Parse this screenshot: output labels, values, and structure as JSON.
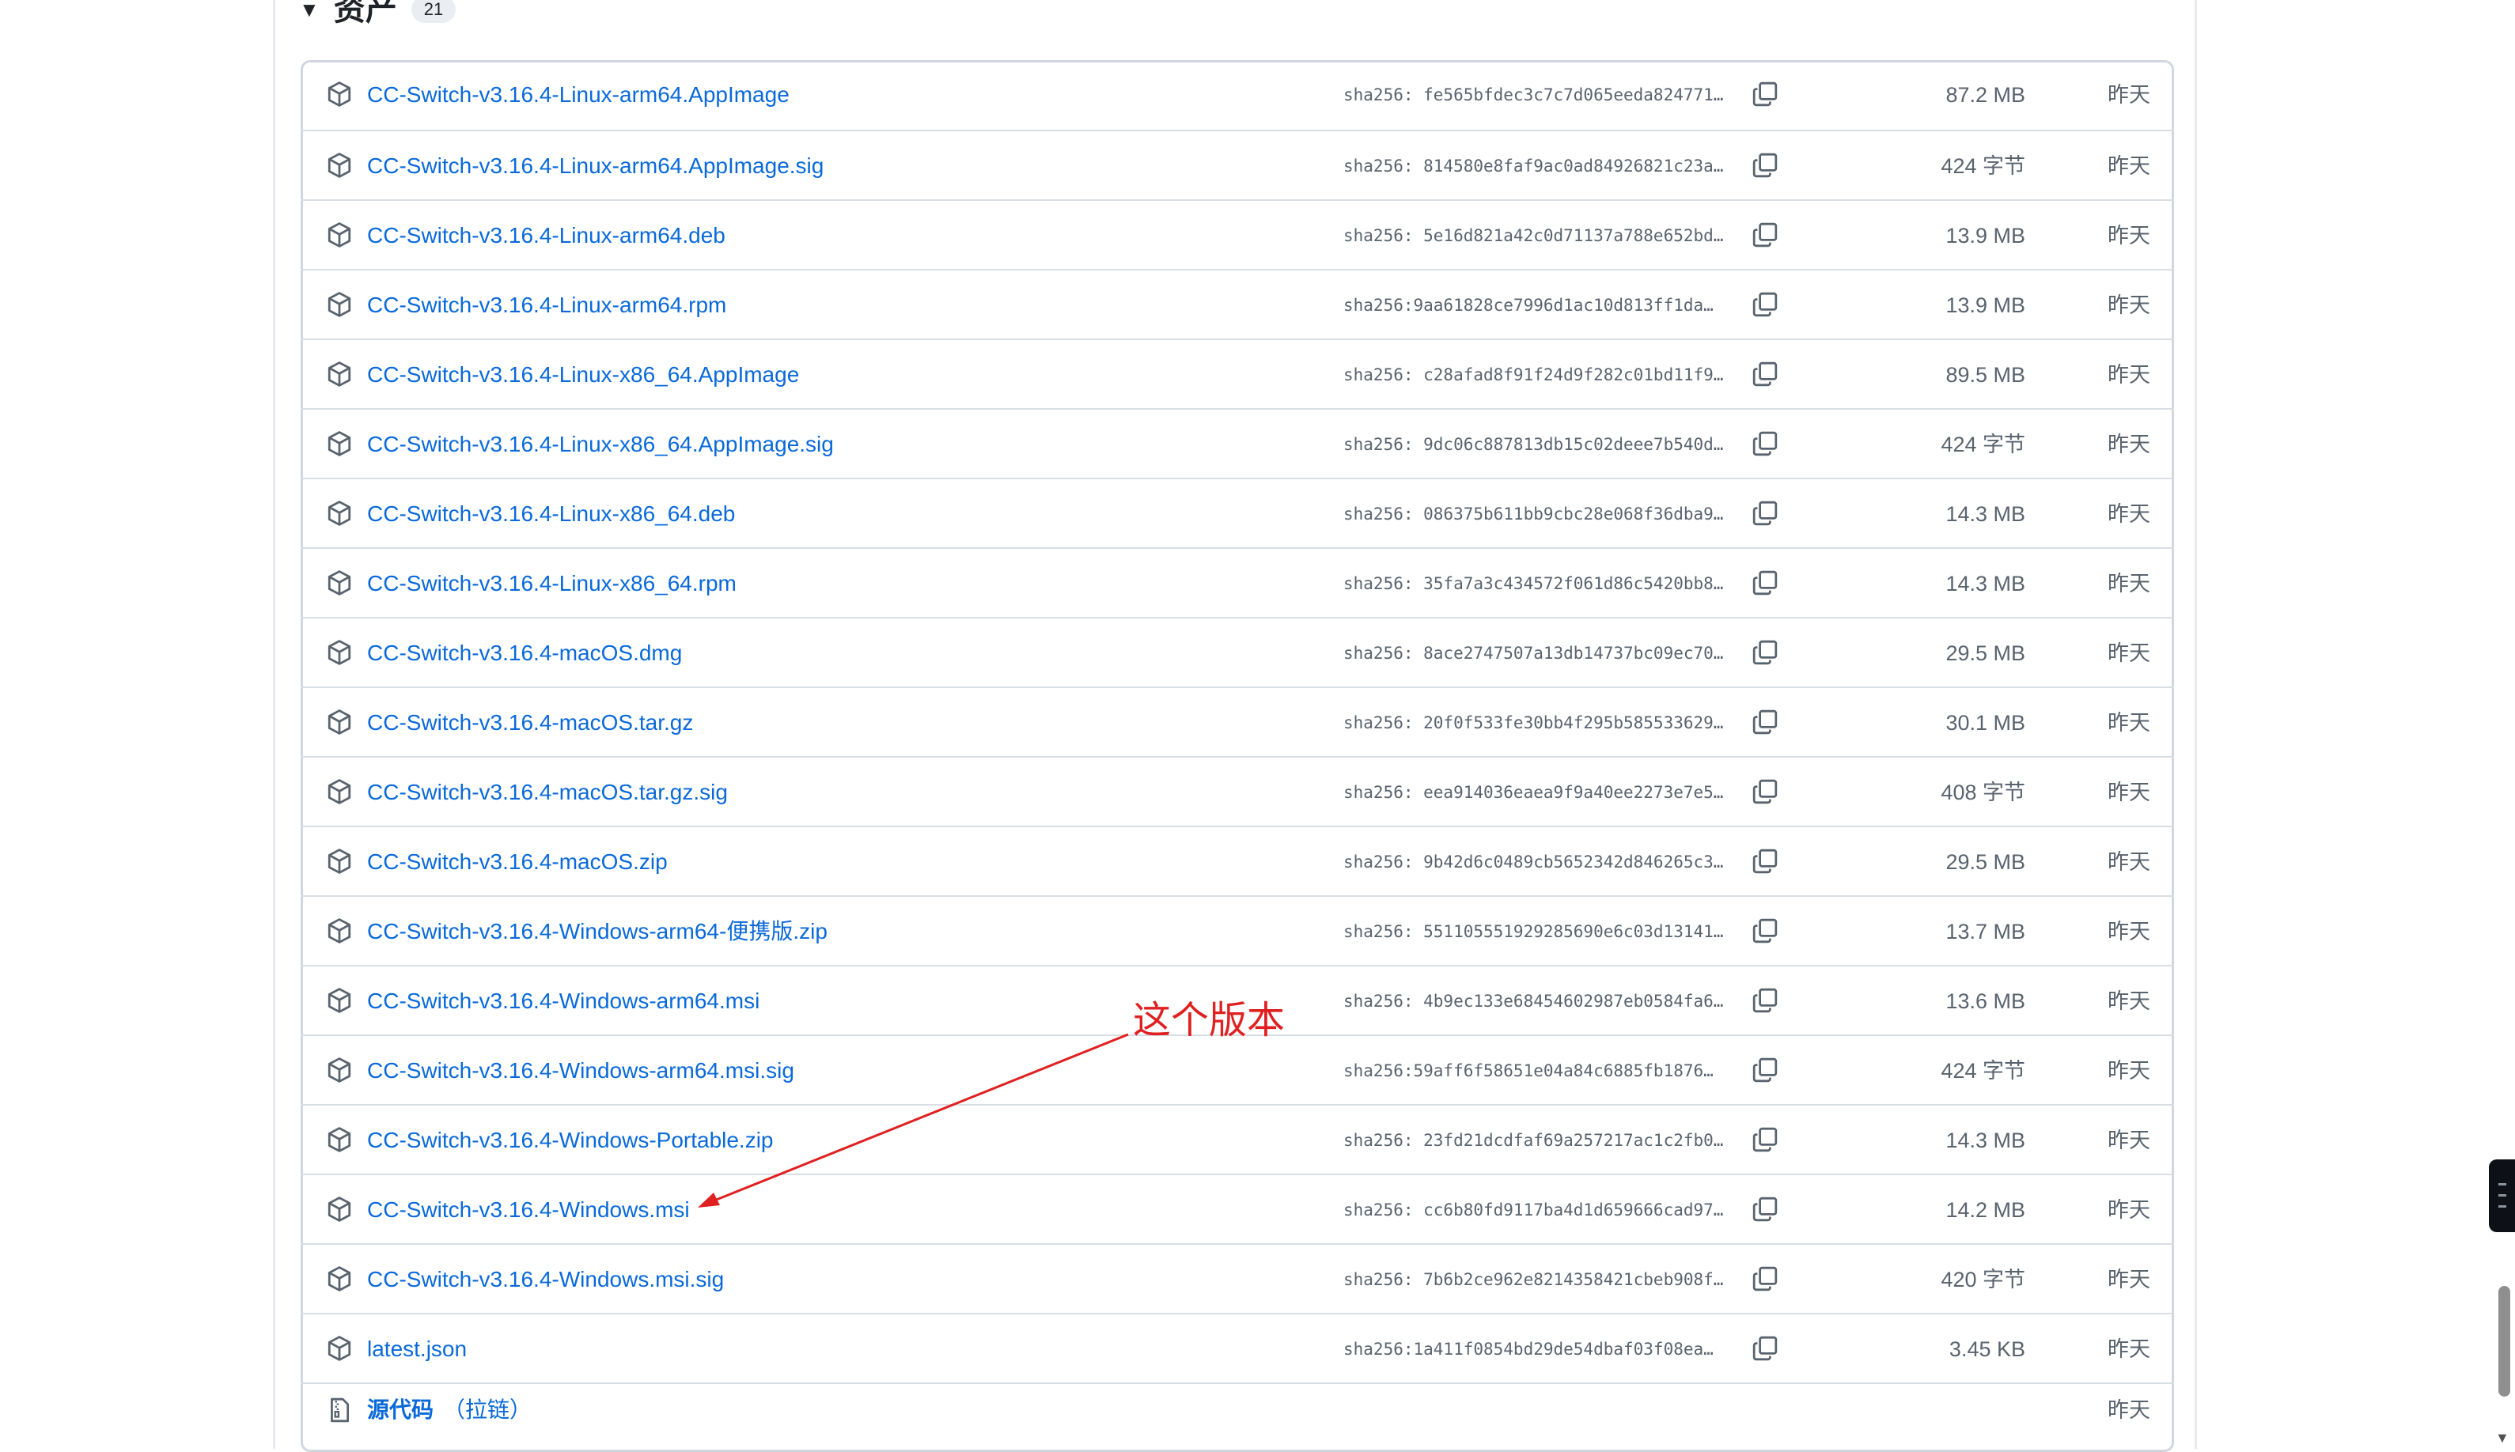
{
  "assets": {
    "title": "资产",
    "count": "21",
    "items": [
      {
        "name": "CC-Switch-v3.16.4-Linux-arm64.AppImage",
        "hash": "sha256: fe565bfdec3c7c7d065eeda824771…",
        "size": "87.2 MB",
        "date": "昨天"
      },
      {
        "name": "CC-Switch-v3.16.4-Linux-arm64.AppImage.sig",
        "hash": "sha256: 814580e8faf9ac0ad84926821c23a…",
        "size": "424 字节",
        "date": "昨天"
      },
      {
        "name": "CC-Switch-v3.16.4-Linux-arm64.deb",
        "hash": "sha256: 5e16d821a42c0d71137a788e652bd…",
        "size": "13.9 MB",
        "date": "昨天"
      },
      {
        "name": "CC-Switch-v3.16.4-Linux-arm64.rpm",
        "hash": "sha256:9aa61828ce7996d1ac10d813ff1da…",
        "size": "13.9 MB",
        "date": "昨天"
      },
      {
        "name": "CC-Switch-v3.16.4-Linux-x86_64.AppImage",
        "hash": "sha256: c28afad8f91f24d9f282c01bd11f9…",
        "size": "89.5 MB",
        "date": "昨天"
      },
      {
        "name": "CC-Switch-v3.16.4-Linux-x86_64.AppImage.sig",
        "hash": "sha256: 9dc06c887813db15c02deee7b540d…",
        "size": "424 字节",
        "date": "昨天"
      },
      {
        "name": "CC-Switch-v3.16.4-Linux-x86_64.deb",
        "hash": "sha256: 086375b611bb9cbc28e068f36dba9…",
        "size": "14.3 MB",
        "date": "昨天"
      },
      {
        "name": "CC-Switch-v3.16.4-Linux-x86_64.rpm",
        "hash": "sha256: 35fa7a3c434572f061d86c5420bb8…",
        "size": "14.3 MB",
        "date": "昨天"
      },
      {
        "name": "CC-Switch-v3.16.4-macOS.dmg",
        "hash": "sha256: 8ace2747507a13db14737bc09ec70…",
        "size": "29.5 MB",
        "date": "昨天"
      },
      {
        "name": "CC-Switch-v3.16.4-macOS.tar.gz",
        "hash": "sha256: 20f0f533fe30bb4f295b585533629…",
        "size": "30.1 MB",
        "date": "昨天"
      },
      {
        "name": "CC-Switch-v3.16.4-macOS.tar.gz.sig",
        "hash": "sha256: eea914036eaea9f9a40ee2273e7e5…",
        "size": "408 字节",
        "date": "昨天"
      },
      {
        "name": "CC-Switch-v3.16.4-macOS.zip",
        "hash": "sha256: 9b42d6c0489cb5652342d846265c3…",
        "size": "29.5 MB",
        "date": "昨天"
      },
      {
        "name": "CC-Switch-v3.16.4-Windows-arm64-便携版.zip",
        "hash": "sha256: 551105551929285690e6c03d13141…",
        "size": "13.7 MB",
        "date": "昨天"
      },
      {
        "name": "CC-Switch-v3.16.4-Windows-arm64.msi",
        "hash": "sha256: 4b9ec133e68454602987eb0584fa6…",
        "size": "13.6 MB",
        "date": "昨天"
      },
      {
        "name": "CC-Switch-v3.16.4-Windows-arm64.msi.sig",
        "hash": "sha256:59aff6f58651e04a84c6885fb1876…",
        "size": "424 字节",
        "date": "昨天"
      },
      {
        "name": "CC-Switch-v3.16.4-Windows-Portable.zip",
        "hash": "sha256: 23fd21dcdfaf69a257217ac1c2fb0…",
        "size": "14.3 MB",
        "date": "昨天"
      },
      {
        "name": "CC-Switch-v3.16.4-Windows.msi",
        "hash": "sha256: cc6b80fd9117ba4d1d659666cad97…",
        "size": "14.2 MB",
        "date": "昨天"
      },
      {
        "name": "CC-Switch-v3.16.4-Windows.msi.sig",
        "hash": "sha256: 7b6b2ce962e8214358421cbeb908f…",
        "size": "420 字节",
        "date": "昨天"
      },
      {
        "name": "latest.json",
        "hash": "sha256:1a411f0854bd29de54dbaf03f08ea…",
        "size": "3.45 KB",
        "date": "昨天"
      }
    ],
    "source": {
      "label": "源代码",
      "type": "（拉链）",
      "date": "昨天"
    }
  },
  "annotation": {
    "text": "这个版本",
    "color": "#e02020"
  },
  "icons": {
    "asset": "package-icon",
    "copy": "copy-icon",
    "source": "file-zip-icon"
  },
  "colors": {
    "link": "#0969da",
    "muted": "#59636e",
    "border": "#d0d7de"
  }
}
